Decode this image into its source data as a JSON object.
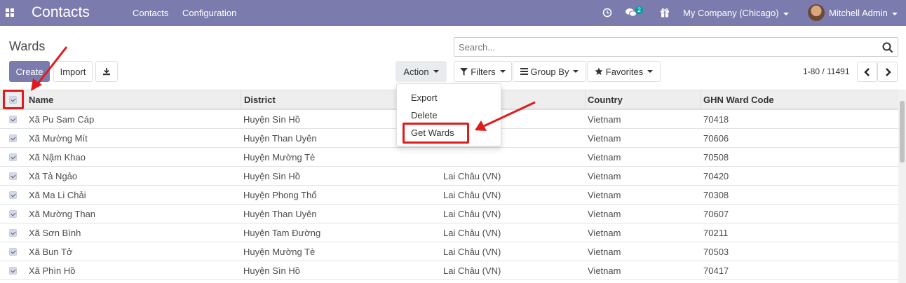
{
  "navbar": {
    "brand": "Contacts",
    "menu": [
      "Contacts",
      "Configuration"
    ],
    "messages_count": "2",
    "company": "My Company (Chicago)",
    "user": "Mitchell Admin",
    "icons": [
      "apps-icon",
      "clock-icon",
      "chat-icon",
      "gift-icon"
    ]
  },
  "page": {
    "title": "Wards",
    "create_label": "Create",
    "import_label": "Import",
    "action_label": "Action",
    "search_placeholder": "Search...",
    "filters_label": "Filters",
    "groupby_label": "Group By",
    "favorites_label": "Favorites",
    "pager": "1-80 / 11491"
  },
  "action_menu": [
    "Export",
    "Delete",
    "Get Wards"
  ],
  "table": {
    "columns": [
      "Name",
      "District",
      "",
      "Country",
      "GHN Ward Code"
    ],
    "rows": [
      [
        "Xã Pu Sam Cáp",
        "Huyện Sìn Hồ",
        "",
        "Vietnam",
        "70418"
      ],
      [
        "Xã Mường Mít",
        "Huyện Than Uyên",
        "",
        "Vietnam",
        "70606"
      ],
      [
        "Xã Nậm Khao",
        "Huyện Mường Tè",
        "",
        "Vietnam",
        "70508"
      ],
      [
        "Xã Tả Ngảo",
        "Huyện Sìn Hồ",
        "Lai Châu (VN)",
        "Vietnam",
        "70420"
      ],
      [
        "Xã Ma Li Chải",
        "Huyện Phong Thổ",
        "Lai Châu (VN)",
        "Vietnam",
        "70308"
      ],
      [
        "Xã Mường Than",
        "Huyện Than Uyên",
        "Lai Châu (VN)",
        "Vietnam",
        "70607"
      ],
      [
        "Xã Sơn Bình",
        "Huyện Tam Đường",
        "Lai Châu (VN)",
        "Vietnam",
        "70211"
      ],
      [
        "Xã Bun Tở",
        "Huyện Mường Tè",
        "Lai Châu (VN)",
        "Vietnam",
        "70503"
      ],
      [
        "Xã Phìn Hồ",
        "Huyện Sìn Hồ",
        "Lai Châu (VN)",
        "Vietnam",
        "70417"
      ]
    ]
  },
  "colors": {
    "navbar": "#7c7bad",
    "primary": "#7c7bad",
    "highlight": "#e01b1b"
  }
}
